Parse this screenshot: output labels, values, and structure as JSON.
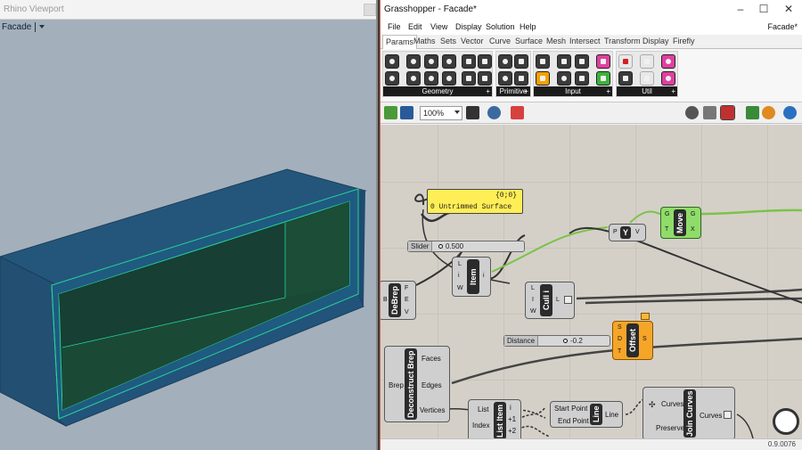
{
  "rhino": {
    "window_title": "Rhino Viewport",
    "viewport_label": "Facade",
    "colors": {
      "background": "#a3b0bb",
      "solid": "#1f4f73",
      "edge": "#27d39a"
    }
  },
  "grasshopper": {
    "window_title": "Grasshopper - Facade*",
    "doc_name": "Facade*",
    "menu": [
      "File",
      "Edit",
      "View",
      "Display",
      "Solution",
      "Help"
    ],
    "tabs": [
      "Params",
      "Maths",
      "Sets",
      "Vector",
      "Curve",
      "Surface",
      "Mesh",
      "Intersect",
      "Transform",
      "Display",
      "Firefly"
    ],
    "active_tab": "Params",
    "groups": [
      "Geometry",
      "Primitive",
      "Input",
      "Util"
    ],
    "zoom": "100%",
    "status_version": "0.9.0076",
    "canvas": {
      "panel": {
        "header": "{0;0}",
        "text": "0 Untrimmed Surface"
      },
      "slider_main": {
        "name": "Slider",
        "value": "0.500"
      },
      "slider_distance": {
        "name": "Distance",
        "value": "-0.2"
      },
      "components": {
        "debrep": {
          "label": "DeBrep",
          "in": [
            "B"
          ],
          "out": [
            "F",
            "E",
            "V"
          ]
        },
        "item": {
          "label": "Item",
          "in": [
            "L",
            "i",
            "W"
          ],
          "out": [
            "i"
          ]
        },
        "cull": {
          "label": "Cull i",
          "in": [
            "L",
            "I",
            "W"
          ],
          "out": [
            "L"
          ]
        },
        "ypt": {
          "label": "Y",
          "in": [
            "P"
          ],
          "out": [
            "V"
          ]
        },
        "move": {
          "label": "Move",
          "in": [
            "G",
            "T"
          ],
          "out": [
            "G",
            "X"
          ]
        },
        "offset": {
          "label": "Offset",
          "in": [
            "S",
            "D",
            "T"
          ],
          "out": [
            "S"
          ]
        },
        "deconstruct": {
          "label": "Deconstruct Brep",
          "in": [
            "Brep"
          ],
          "out": [
            "Faces",
            "Edges",
            "Vertices"
          ]
        },
        "listitem": {
          "label": "List Item",
          "in": [
            "List",
            "Index"
          ],
          "out": [
            "i",
            "+1",
            "+2"
          ]
        },
        "line": {
          "label": "Line",
          "in": [
            "Start Point",
            "End Point"
          ],
          "out": [
            "Line"
          ]
        },
        "join": {
          "label": "Join Curves",
          "in": [
            "Curves",
            "Preserve"
          ],
          "out": [
            "Curves"
          ]
        }
      }
    }
  }
}
